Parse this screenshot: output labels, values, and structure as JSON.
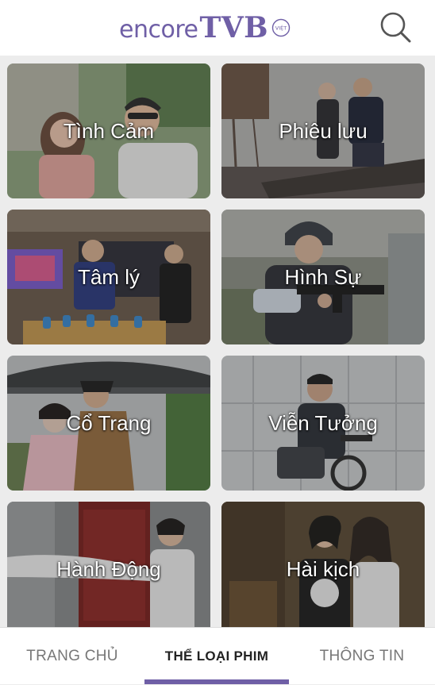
{
  "header": {
    "logo_encore": "encore",
    "logo_tvb": "TVB",
    "logo_badge": "VIỆT",
    "brand_color": "#6f5fa6",
    "search_icon": "search-icon"
  },
  "genres": [
    {
      "label": "Tình Cảm"
    },
    {
      "label": "Phiêu lưu"
    },
    {
      "label": "Tâm lý"
    },
    {
      "label": "Hình Sự"
    },
    {
      "label": "Cổ Trang"
    },
    {
      "label": "Viễn Tưởng"
    },
    {
      "label": "Hành Động"
    },
    {
      "label": "Hài kịch"
    }
  ],
  "bottom_nav": {
    "home": "TRANG CHỦ",
    "genres": "THỂ LOẠI PHIM",
    "info": "THÔNG TIN",
    "active": "genres"
  }
}
